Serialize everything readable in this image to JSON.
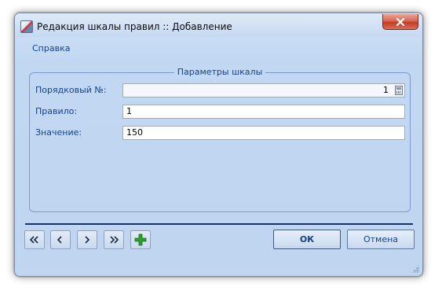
{
  "window": {
    "title": "Редакция шкалы правил :: Добавление"
  },
  "menu": {
    "items": [
      "Справка"
    ]
  },
  "group": {
    "title": "Параметры шкалы"
  },
  "fields": [
    {
      "label": "Порядковый №:",
      "value": "1"
    },
    {
      "label": "Правило:",
      "value": "1"
    },
    {
      "label": "Значение:",
      "value": "150"
    }
  ],
  "navigation": {
    "first": "first-icon",
    "prev": "prev-icon",
    "next": "next-icon",
    "last": "last-icon",
    "add": "add-icon"
  },
  "buttons": {
    "ok": "ОК",
    "cancel": "Отмена"
  },
  "colors": {
    "window_bg": "#c2d8f2",
    "label_text": "#15428b",
    "add_icon": "#2e9e2e",
    "close_button": "#c43b24",
    "separator": "#14346a"
  }
}
